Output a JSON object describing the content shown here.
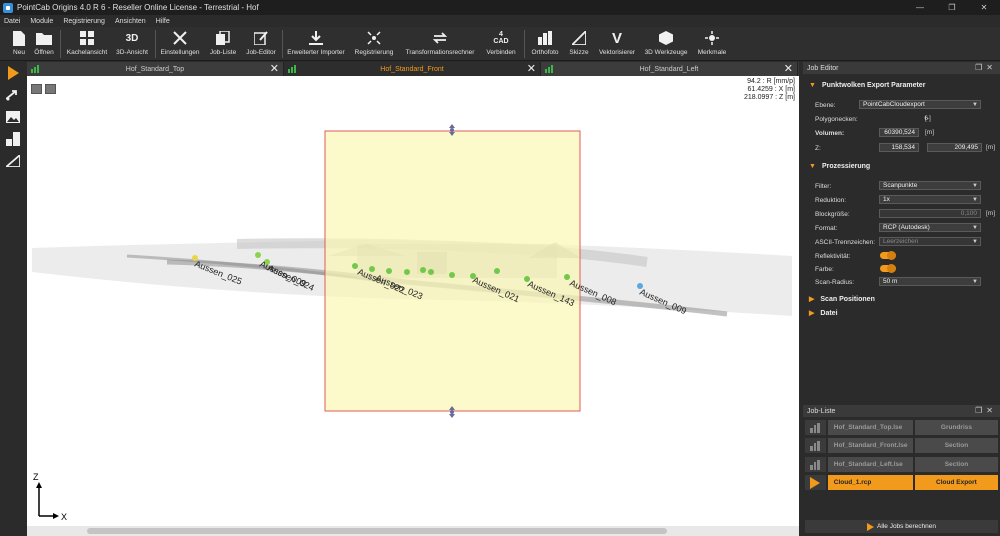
{
  "window": {
    "title": "PointCab Origins 4.0 R 6 - Reseller Online License - Terrestrial - Hof"
  },
  "menu": [
    "Datei",
    "Module",
    "Registrierung",
    "Ansichten",
    "Hilfe"
  ],
  "toolbar": {
    "neu": "Neu",
    "oeffnen": "Öffnen",
    "kachelansicht": "Kachelansicht",
    "dreid_ansicht": "3D-Ansicht",
    "dreid_glyph": "3D",
    "einstellungen": "Einstellungen",
    "job_liste": "Job-Liste",
    "job_editor": "Job-Editor",
    "importer": "Erweiterter Importer",
    "registrierung": "Registrierung",
    "transformation": "Transformationsrechner",
    "verbinden": "Verbinden",
    "cad_num": "4",
    "cad_glyph": "CAD",
    "orthofoto": "Orthofoto",
    "skizze": "Skizze",
    "vektorisierer": "Vektorisierer",
    "werkzeuge": "3D Werkzeuge",
    "merkmale": "Merkmale"
  },
  "tabs": [
    {
      "label": "Hof_Standard_Top",
      "active": false
    },
    {
      "label": "Hof_Standard_Front",
      "active": true
    },
    {
      "label": "Hof_Standard_Left",
      "active": false
    }
  ],
  "viewport": {
    "readout": [
      "94.2 : R [mm/p]",
      "61.4259 : X [m]",
      "218.0997 : Z [m]"
    ],
    "axis_z": "Z",
    "axis_x": "X",
    "scans": [
      "Aussen_025",
      "Aussen_009",
      "Aussen_024",
      "Aussen_022",
      "Aussen_023",
      "Aussen_021",
      "Aussen_143",
      "Aussen_008",
      "Aussen_009"
    ]
  },
  "job_editor": {
    "title": "Job Editor",
    "section1": "Punktwolken Export Parameter",
    "ebene_label": "Ebene:",
    "ebene_value": "PointCabCloudexport",
    "polygonecken_label": "Polygonecken:",
    "polygonecken_value": "6",
    "polygonecken_unit": "[-]",
    "volumen_label": "Volumen:",
    "volumen_value": "60390,524",
    "volumen_unit": "[m]",
    "z_label": "Z:",
    "z_min": "158,534",
    "z_max": "209,495",
    "z_unit": "[m]",
    "section2": "Prozessierung",
    "filter_label": "Filter:",
    "filter_value": "Scanpunkte",
    "reduktion_label": "Reduktion:",
    "reduktion_value": "1x",
    "block_label": "Blockgröße:",
    "block_value": "0,100",
    "block_unit": "[m]",
    "format_label": "Format:",
    "format_value": "RCP (Autodesk)",
    "ascii_label": "ASCII-Trennzeichen:",
    "ascii_value": "Leerzeichen",
    "reflekt_label": "Reflektivität:",
    "farbe_label": "Farbe:",
    "scanradius_label": "Scan-Radius:",
    "scanradius_value": "50 m",
    "section3": "Scan Positionen",
    "section4": "Datei"
  },
  "job_list": {
    "title": "Job-Liste",
    "jobs": [
      {
        "name": "Hof_Standard_Top.lse",
        "type": "Grundriss"
      },
      {
        "name": "Hof_Standard_Front.lse",
        "type": "Section"
      },
      {
        "name": "Hof_Standard_Left.lse",
        "type": "Section"
      },
      {
        "name": "Cloud_1.rcp",
        "type": "Cloud Export"
      }
    ],
    "calc_all": "Alle Jobs berechnen"
  },
  "colors": {
    "accent": "#f29a1c",
    "selection_fill": "#fbf8b4",
    "selection_border": "#e05a5a"
  }
}
